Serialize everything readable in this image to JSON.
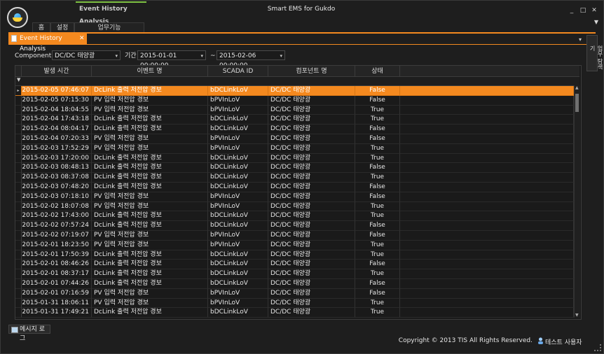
{
  "window": {
    "app_tab": "Event History Analysis",
    "title": "Smart EMS for Gukdo",
    "minimize": "_",
    "maximize": "□",
    "close": "✕",
    "collapse": "▼"
  },
  "ribbon": {
    "tabs": [
      "홈",
      "설정",
      "업무기능"
    ]
  },
  "document_tab": {
    "label": "Event History Analysis",
    "close": "✕",
    "dropdown": "▾"
  },
  "side_panel": {
    "label": "업무 탐색기"
  },
  "filter": {
    "component_label": "ComponentID",
    "component_value": "DC/DC 태양광",
    "period_label": "기간",
    "start": "2015-01-01 00:00:00",
    "tilde": "~",
    "end": "2015-02-06 00:00:00",
    "dropdown_glyph": "▾"
  },
  "grid": {
    "columns": [
      "발생 시간",
      "이벤트 명",
      "SCADA ID",
      "컴포넌트 명",
      "상태"
    ],
    "filter_glyph": "▼",
    "row_indicator": "▸",
    "rows": [
      [
        "2015-02-05 07:46:07",
        "DcLink 출력 저전압 경보",
        "bDCLinkLoV",
        "DC/DC 태양광",
        "False"
      ],
      [
        "2015-02-05 07:15:30",
        "PV 입력 저전압 경보",
        "bPVInLoV",
        "DC/DC 태양광",
        "False"
      ],
      [
        "2015-02-04 18:04:55",
        "PV 입력 저전압 경보",
        "bPVInLoV",
        "DC/DC 태양광",
        "True"
      ],
      [
        "2015-02-04 17:43:18",
        "DcLink 출력 저전압 경보",
        "bDCLinkLoV",
        "DC/DC 태양광",
        "True"
      ],
      [
        "2015-02-04 08:04:17",
        "DcLink 출력 저전압 경보",
        "bDCLinkLoV",
        "DC/DC 태양광",
        "False"
      ],
      [
        "2015-02-04 07:20:33",
        "PV 입력 저전압 경보",
        "bPVInLoV",
        "DC/DC 태양광",
        "False"
      ],
      [
        "2015-02-03 17:52:29",
        "PV 입력 저전압 경보",
        "bPVInLoV",
        "DC/DC 태양광",
        "True"
      ],
      [
        "2015-02-03 17:20:00",
        "DcLink 출력 저전압 경보",
        "bDCLinkLoV",
        "DC/DC 태양광",
        "True"
      ],
      [
        "2015-02-03 08:48:13",
        "DcLink 출력 저전압 경보",
        "bDCLinkLoV",
        "DC/DC 태양광",
        "False"
      ],
      [
        "2015-02-03 08:37:08",
        "DcLink 출력 저전압 경보",
        "bDCLinkLoV",
        "DC/DC 태양광",
        "True"
      ],
      [
        "2015-02-03 07:48:20",
        "DcLink 출력 저전압 경보",
        "bDCLinkLoV",
        "DC/DC 태양광",
        "False"
      ],
      [
        "2015-02-03 07:18:10",
        "PV 입력 저전압 경보",
        "bPVInLoV",
        "DC/DC 태양광",
        "False"
      ],
      [
        "2015-02-02 18:07:08",
        "PV 입력 저전압 경보",
        "bPVInLoV",
        "DC/DC 태양광",
        "True"
      ],
      [
        "2015-02-02 17:43:00",
        "DcLink 출력 저전압 경보",
        "bDCLinkLoV",
        "DC/DC 태양광",
        "True"
      ],
      [
        "2015-02-02 07:57:24",
        "DcLink 출력 저전압 경보",
        "bDCLinkLoV",
        "DC/DC 태양광",
        "False"
      ],
      [
        "2015-02-02 07:19:07",
        "PV 입력 저전압 경보",
        "bPVInLoV",
        "DC/DC 태양광",
        "False"
      ],
      [
        "2015-02-01 18:23:50",
        "PV 입력 저전압 경보",
        "bPVInLoV",
        "DC/DC 태양광",
        "True"
      ],
      [
        "2015-02-01 17:50:39",
        "DcLink 출력 저전압 경보",
        "bDCLinkLoV",
        "DC/DC 태양광",
        "True"
      ],
      [
        "2015-02-01 08:46:26",
        "DcLink 출력 저전압 경보",
        "bDCLinkLoV",
        "DC/DC 태양광",
        "False"
      ],
      [
        "2015-02-01 08:37:17",
        "DcLink 출력 저전압 경보",
        "bDCLinkLoV",
        "DC/DC 태양광",
        "True"
      ],
      [
        "2015-02-01 07:44:26",
        "DcLink 출력 저전압 경보",
        "bDCLinkLoV",
        "DC/DC 태양광",
        "False"
      ],
      [
        "2015-02-01 07:16:59",
        "PV 입력 저전압 경보",
        "bPVInLoV",
        "DC/DC 태양광",
        "False"
      ],
      [
        "2015-01-31 18:06:11",
        "PV 입력 저전압 경보",
        "bPVInLoV",
        "DC/DC 태양광",
        "True"
      ],
      [
        "2015-01-31 17:49:21",
        "DcLink 출력 저전압 경보",
        "bDCLinkLoV",
        "DC/DC 태양광",
        "True"
      ]
    ],
    "selected_row": 0
  },
  "footer": {
    "message_log": "메시지 로그",
    "copyright": "Copyright © 2013 TIS All Rights Reserved.",
    "user": "테스트 사용자"
  },
  "colors": {
    "accent": "#f4891f",
    "app_tab_indicator": "#7ec242",
    "background": "#1e1e1e"
  }
}
